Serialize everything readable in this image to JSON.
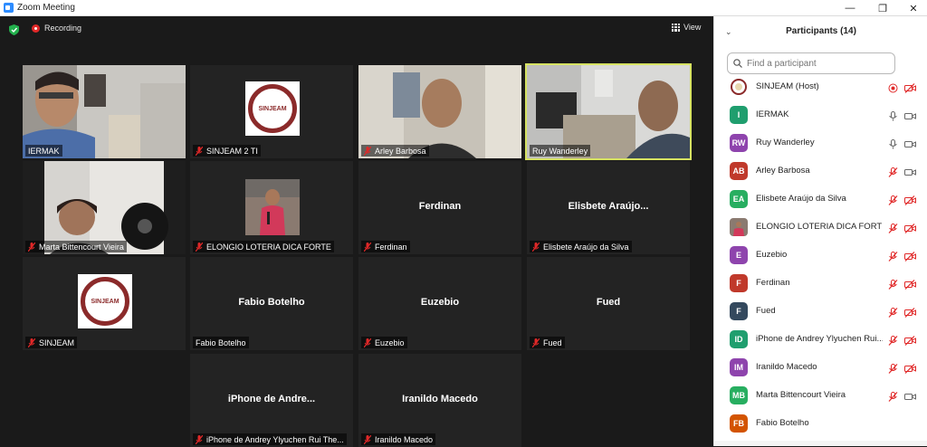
{
  "window": {
    "title": "Zoom Meeting",
    "minimize": "—",
    "restore": "❐",
    "close": "✕"
  },
  "topbar": {
    "recording_label": "Recording",
    "view_label": "View"
  },
  "tiles": [
    {
      "label": "IERMAK",
      "muted": false
    },
    {
      "label": "SINJEAM 2 TI",
      "muted": true,
      "logo_text": "SINJEAM"
    },
    {
      "label": "Arley Barbosa",
      "muted": true
    },
    {
      "label": "Ruy Wanderley",
      "muted": false
    },
    {
      "label": "Marta Bittencourt Vieira",
      "muted": true
    },
    {
      "label": "ELONGIO LOTERIA DICA FORTE",
      "muted": true
    },
    {
      "center": "Ferdinan",
      "label": "Ferdinan",
      "muted": true
    },
    {
      "center": "Elisbete  Araújo...",
      "label": "Elisbete Araújo da Silva",
      "muted": true
    },
    {
      "label": "SINJEAM",
      "muted": true,
      "logo_text": "SINJEAM"
    },
    {
      "center": "Fabio Botelho",
      "label": "Fabio Botelho",
      "muted": false
    },
    {
      "center": "Euzebio",
      "label": "Euzebio",
      "muted": true
    },
    {
      "center": "Fued",
      "label": "Fued",
      "muted": true
    },
    {
      "center": "iPhone de Andre...",
      "label": "iPhone de Andrey Ylyuchen Rui The...",
      "muted": true
    },
    {
      "center": "Iranildo Macedo",
      "label": "Iranildo Macedo",
      "muted": true
    }
  ],
  "panel": {
    "title": "Participants (14)",
    "search_placeholder": "Find a participant",
    "participants": [
      {
        "name": "SINJEAM (Host)",
        "initials": "",
        "color": "#ffffff",
        "audio": "recording",
        "video": "off"
      },
      {
        "name": "IERMAK",
        "initials": "I",
        "color": "#1f9e6e",
        "audio": "on",
        "video": "on"
      },
      {
        "name": "Ruy Wanderley",
        "initials": "RW",
        "color": "#8e44ad",
        "audio": "on",
        "video": "on"
      },
      {
        "name": "Arley Barbosa",
        "initials": "AB",
        "color": "#c0392b",
        "audio": "muted",
        "video": "on"
      },
      {
        "name": "Elisbete Araújo da Silva",
        "initials": "EA",
        "color": "#27ae60",
        "audio": "muted",
        "video": "off"
      },
      {
        "name": "ELONGIO LOTERIA DICA FORTE",
        "initials": "",
        "color": "#d87aa8",
        "audio": "muted",
        "video": "off"
      },
      {
        "name": "Euzebio",
        "initials": "E",
        "color": "#8e44ad",
        "audio": "muted",
        "video": "off"
      },
      {
        "name": "Ferdinan",
        "initials": "F",
        "color": "#c0392b",
        "audio": "muted",
        "video": "off"
      },
      {
        "name": "Fued",
        "initials": "F",
        "color": "#34495e",
        "audio": "muted",
        "video": "off"
      },
      {
        "name": "iPhone de Andrey Ylyuchen Rui...",
        "initials": "ID",
        "color": "#1f9e6e",
        "audio": "muted",
        "video": "off"
      },
      {
        "name": "Iranildo Macedo",
        "initials": "IM",
        "color": "#8e44ad",
        "audio": "muted",
        "video": "off"
      },
      {
        "name": "Marta Bittencourt Vieira",
        "initials": "MB",
        "color": "#27ae60",
        "audio": "muted",
        "video": "on"
      },
      {
        "name": "Fabio Botelho",
        "initials": "FB",
        "color": "#d35400",
        "audio": "none",
        "video": "none"
      }
    ]
  },
  "colors": {
    "muted_icon": "#e02828",
    "speaking_border": "#d6e262",
    "icon_gray": "#666666"
  }
}
